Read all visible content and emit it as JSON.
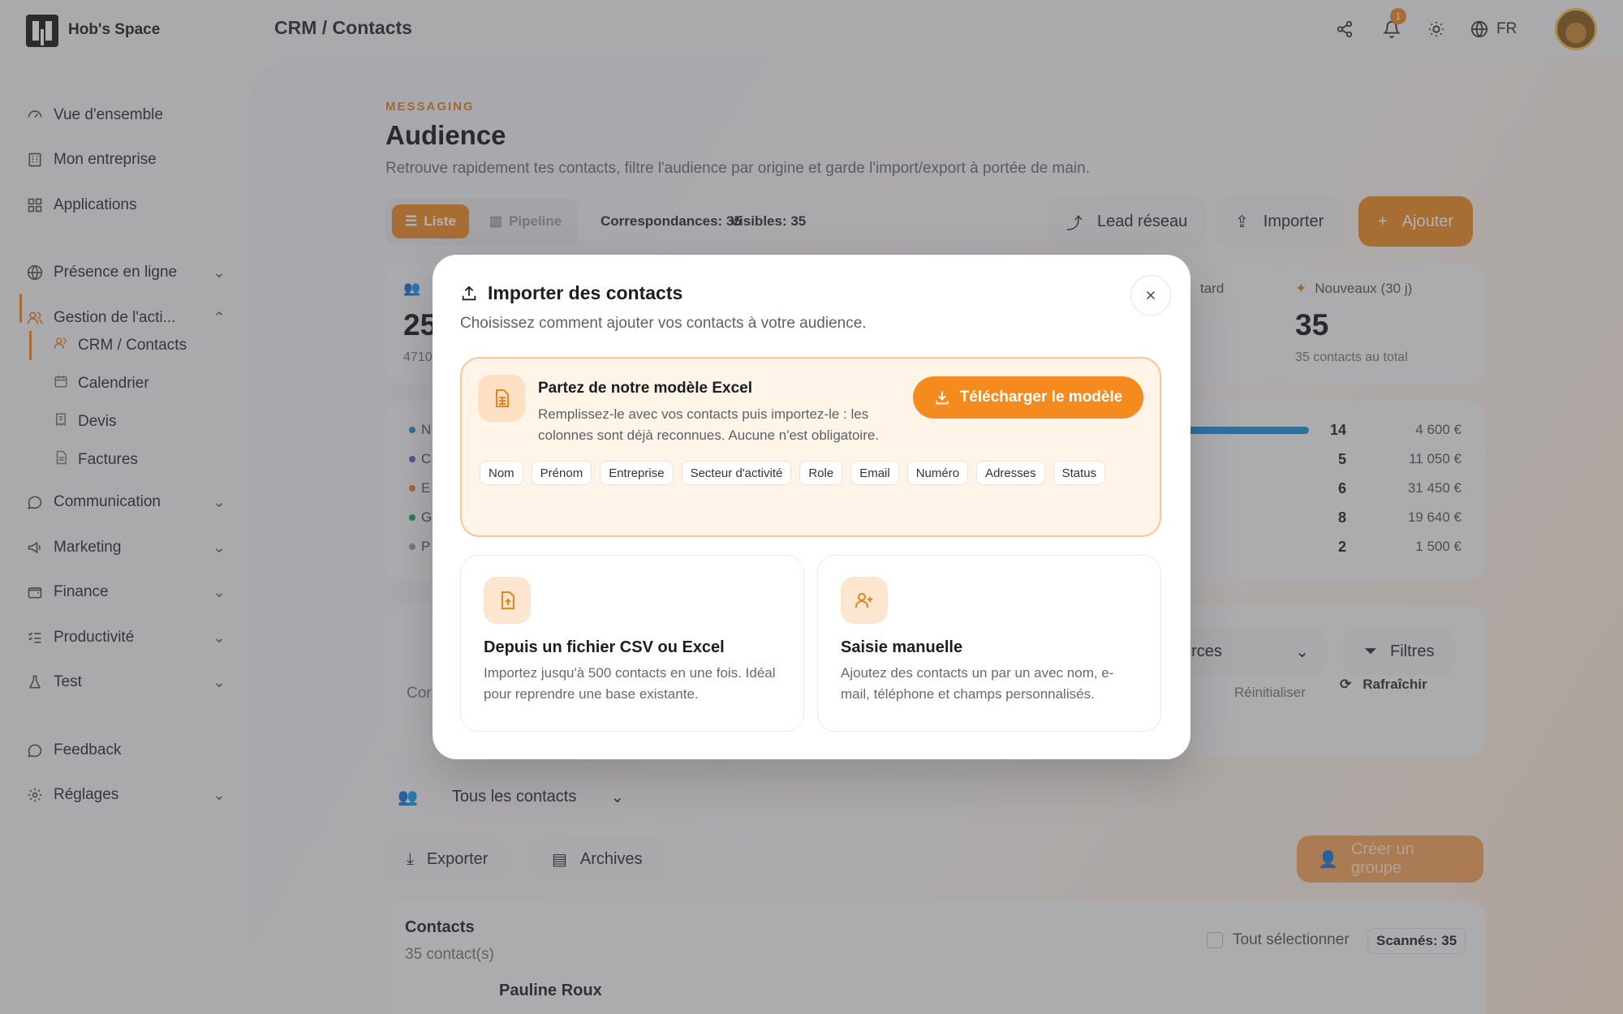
{
  "topbar": {
    "brand": "Hob's Space",
    "breadcrumb": "CRM / Contacts",
    "notification_count": "1",
    "language": "FR"
  },
  "sidebar": {
    "items": [
      {
        "label": "Vue d'ensemble",
        "icon": "gauge-icon"
      },
      {
        "label": "Mon entreprise",
        "icon": "building-icon"
      },
      {
        "label": "Applications",
        "icon": "grid-icon"
      },
      {
        "label": "Présence en ligne",
        "icon": "globe-icon"
      },
      {
        "label": "Gestion de l'acti...",
        "icon": "users-icon"
      },
      {
        "label": "Communication",
        "icon": "chat-icon"
      },
      {
        "label": "Marketing",
        "icon": "megaphone-icon"
      },
      {
        "label": "Finance",
        "icon": "wallet-icon"
      },
      {
        "label": "Productivité",
        "icon": "checklist-icon"
      },
      {
        "label": "Test",
        "icon": "flask-icon"
      },
      {
        "label": "Feedback",
        "icon": "chat-icon"
      },
      {
        "label": "Réglages",
        "icon": "gear-icon"
      }
    ],
    "sub_items": [
      {
        "label": "CRM / Contacts",
        "icon": "users-icon"
      },
      {
        "label": "Calendrier",
        "icon": "calendar-icon"
      },
      {
        "label": "Devis",
        "icon": "receipt-icon"
      },
      {
        "label": "Factures",
        "icon": "file-icon"
      }
    ]
  },
  "page": {
    "eyebrow": "MESSAGING",
    "title": "Audience",
    "subtitle": "Retrouve rapidement tes contacts, filtre l'audience par origine et garde l'import/export à portée de main.",
    "view_list": "Liste",
    "view_pipeline": "Pipeline",
    "matches": "Correspondances: 35",
    "visible": "Visibles: 35",
    "btn_lead": "Lead réseau",
    "btn_import": "Importer",
    "btn_add": "Ajouter"
  },
  "stats": {
    "card1_val": "25",
    "card1_note": "4710",
    "card3_title": "tard",
    "new_title": "Nouveaux (30 j)",
    "new_val": "35",
    "new_note": "35 contacts au total"
  },
  "sources": [
    {
      "letter": "N",
      "color": "#1f8fd6",
      "count": "14",
      "amount": "4 600 €"
    },
    {
      "letter": "C",
      "color": "#7b4fd8",
      "count": "5",
      "amount": "11 050 €"
    },
    {
      "letter": "E",
      "color": "#e8822a",
      "count": "6",
      "amount": "31 450 €"
    },
    {
      "letter": "G",
      "color": "#22a06b",
      "count": "8",
      "amount": "19 640 €"
    },
    {
      "letter": "P",
      "color": "#9a9aa0",
      "count": "2",
      "amount": "1 500 €"
    }
  ],
  "filters": {
    "search_partial": "C",
    "sources_partial": "urces",
    "filters_btn": "Filtres",
    "counter_partial": "Cor",
    "reset": "Réinitialiser",
    "refresh": "Rafraîchir"
  },
  "lower": {
    "group_select": "Tous les contacts",
    "export": "Exporter",
    "archives": "Archives",
    "create_group": "Créer un groupe",
    "contacts_title": "Contacts",
    "contacts_count": "35 contact(s)",
    "select_all": "Tout sélectionner",
    "scanned": "Scannés: 35",
    "first_contact": "Pauline Roux"
  },
  "modal": {
    "title": "Importer des contacts",
    "subtitle": "Choisissez comment ajouter vos contacts à votre audience.",
    "template_title": "Partez de notre modèle Excel",
    "template_desc": "Remplissez-le avec vos contacts puis importez-le : les colonnes sont déjà reconnues. Aucune n'est obligatoire.",
    "template_button": "Télécharger le modèle",
    "columns": [
      "Nom",
      "Prénom",
      "Entreprise",
      "Secteur d'activité",
      "Role",
      "Email",
      "Numéro",
      "Adresses",
      "Status"
    ],
    "csv_title": "Depuis un fichier CSV ou Excel",
    "csv_desc": "Importez jusqu'à 500 contacts en une fois. Idéal pour reprendre une base existante.",
    "manual_title": "Saisie manuelle",
    "manual_desc": "Ajoutez des contacts un par un avec nom, e-mail, téléphone et champs personnalisés."
  },
  "colors": {
    "accent": "#f08a24",
    "accent_light": "#fff4e8"
  }
}
